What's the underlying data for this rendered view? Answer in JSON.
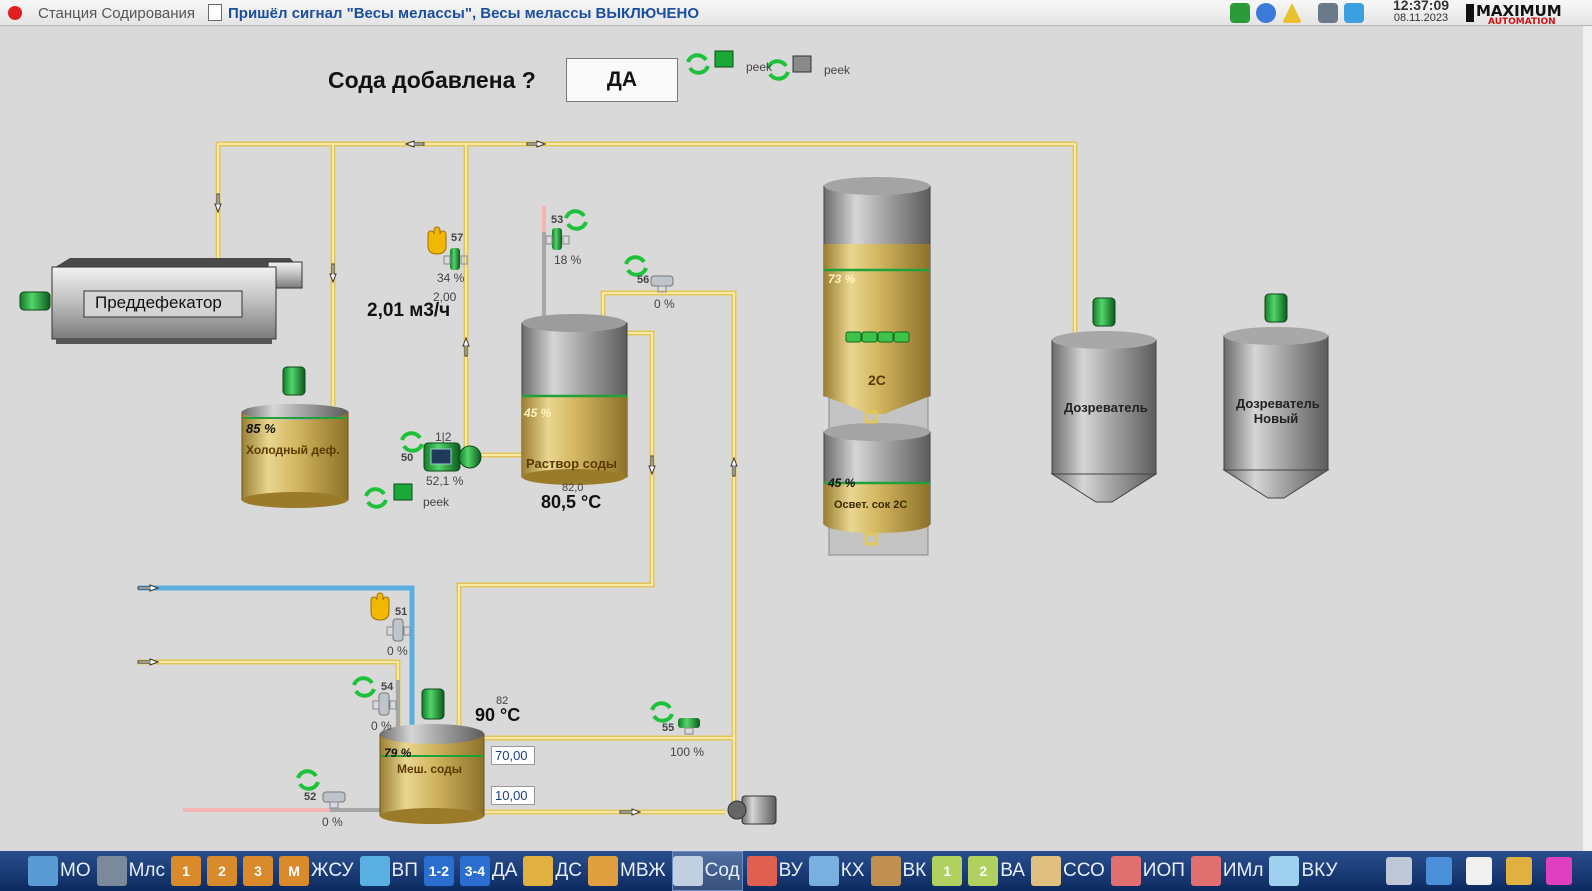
{
  "titlebar": {
    "app": "Станция Содирования",
    "message": "Пришёл сигнал \"Весы мелассы\", Весы мелассы ВЫКЛЮЧЕНО",
    "time": "12:37:09",
    "date": "08.11.2023",
    "logo": "MAXIMUM AUTOMATION"
  },
  "header": {
    "question": "Сода добавлена ?",
    "answer": "ДА",
    "peek": "peek"
  },
  "predefecator": {
    "label": "Преддефекатор"
  },
  "flow": {
    "value": "2,01 м3/ч",
    "setpoint": "2,00"
  },
  "valves": {
    "v57": {
      "id": "57",
      "pct": "34 %"
    },
    "v53": {
      "id": "53",
      "pct": "18 %"
    },
    "v56": {
      "id": "56",
      "pct": "0 %"
    },
    "v51": {
      "id": "51",
      "pct": "0 %"
    },
    "v54": {
      "id": "54",
      "pct": "0 %"
    },
    "v55": {
      "id": "55",
      "pct": "100 %"
    },
    "v52": {
      "id": "52",
      "pct": "0 %"
    }
  },
  "pump": {
    "id": "50",
    "stage": "1|2",
    "pct": "52,1 %",
    "peek": "peek"
  },
  "tanks": {
    "cold_def": {
      "label": "Холодный деф.",
      "level": "85 %"
    },
    "soda_solution": {
      "label": "Раствор соды",
      "level": "45 %",
      "temp": "80,5 °C",
      "temp_sp": "82,0"
    },
    "tank2c": {
      "label": "2С",
      "level": "73 %"
    },
    "clarified": {
      "label": "Освет. сок 2С",
      "level": "45 %"
    },
    "maturer": {
      "label": "Дозреватель"
    },
    "maturer_new": {
      "label": "Дозреватель Новый",
      "line1": "Дозреватель",
      "line2": "Новый"
    },
    "soda_mixer": {
      "label": "Меш. соды",
      "level": "79 %",
      "temp": "90 °C",
      "temp_sp": "82",
      "in1": "70,00",
      "in2": "10,00"
    }
  },
  "taskbar": [
    {
      "label": "МО",
      "icon": "map-icon",
      "color": "#5b9bd5"
    },
    {
      "label": "Млс",
      "icon": "molasses-icon",
      "color": "#7a8a9a"
    },
    {
      "label": "",
      "icon": "1",
      "color": "#d98a2a"
    },
    {
      "label": "",
      "icon": "2",
      "color": "#d98a2a"
    },
    {
      "label": "",
      "icon": "3",
      "color": "#d98a2a"
    },
    {
      "label": "ЖСУ",
      "icon": "M",
      "color": "#d98a2a"
    },
    {
      "label": "ВП",
      "icon": "vp-icon",
      "color": "#5ab0e0"
    },
    {
      "label": "",
      "icon": "1-2",
      "color": "#2a6fd0"
    },
    {
      "label": "ДА",
      "icon": "3-4",
      "color": "#2a6fd0"
    },
    {
      "label": "ДС",
      "icon": "ds-icon",
      "color": "#e0b040"
    },
    {
      "label": "МВЖ",
      "icon": "mvzh-icon",
      "color": "#e0a040"
    },
    {
      "label": "Сод",
      "icon": "sod-icon",
      "color": "#c0d0e0",
      "selected": true
    },
    {
      "label": "ВУ",
      "icon": "vu-icon",
      "color": "#e06050"
    },
    {
      "label": "КХ",
      "icon": "kh-icon",
      "color": "#7ab0e0"
    },
    {
      "label": "ВК",
      "icon": "vk-icon",
      "color": "#c09050"
    },
    {
      "label": "",
      "icon": "1",
      "color": "#b0d060"
    },
    {
      "label": "ВА",
      "icon": "2",
      "color": "#b0d060"
    },
    {
      "label": "ССО",
      "icon": "sso-icon",
      "color": "#e0c080"
    },
    {
      "label": "ИОП",
      "icon": "iop-icon",
      "color": "#e07070"
    },
    {
      "label": "ИМл",
      "icon": "iml-icon",
      "color": "#e07070"
    },
    {
      "label": "ВКУ",
      "icon": "vku-icon",
      "color": "#a0d0f0"
    }
  ],
  "colors": {
    "pipe_yellow": "#e8cf6a",
    "pipe_blue": "#6ab6e0",
    "pipe_pink": "#f2b8b8",
    "level_green": "#1fa23a",
    "gold": "#c9a94a",
    "refresh_green": "#1ec23a"
  }
}
